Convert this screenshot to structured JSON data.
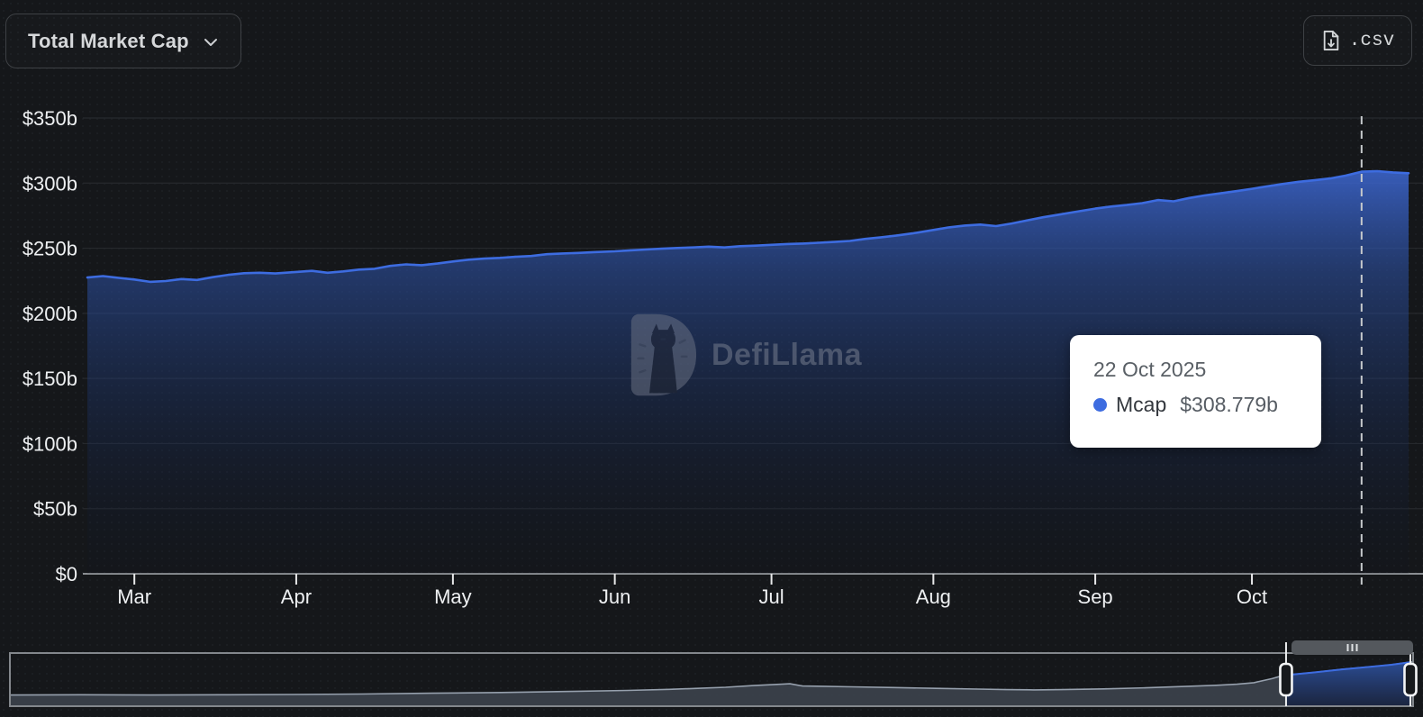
{
  "header": {
    "metric_selector_label": "Total Market Cap",
    "csv_button_label": ".csv"
  },
  "watermark": {
    "brand": "DefiLlama"
  },
  "tooltip": {
    "date": "22 Oct 2025",
    "series_label": "Mcap",
    "value": "$308.779b"
  },
  "colors": {
    "accent_blue": "#3d6ce0",
    "area_fill_top": "#2f57ac",
    "background": "#15171a",
    "axis_text": "#eef0f2",
    "grid_line": "#26292d",
    "axis_line": "#8a8e92",
    "crosshair": "#c6c9cc",
    "tooltip_bg": "#ffffff",
    "nav_gray_fill": "#3c424d",
    "nav_gray_line": "#96a0ad",
    "nav_border": "#83878c",
    "nav_handle": "#f4f5f6"
  },
  "chart_data": {
    "type": "area",
    "title": "Total Market Cap",
    "unit": "USD billions",
    "ylim": [
      0,
      350
    ],
    "grid": true,
    "legend_position": "none",
    "yticks": [
      {
        "value": 0,
        "label": "$0"
      },
      {
        "value": 50,
        "label": "$50b"
      },
      {
        "value": 100,
        "label": "$100b"
      },
      {
        "value": 150,
        "label": "$150b"
      },
      {
        "value": 200,
        "label": "$200b"
      },
      {
        "value": 250,
        "label": "$250b"
      },
      {
        "value": 300,
        "label": "$300b"
      },
      {
        "value": 350,
        "label": "$350b"
      }
    ],
    "xticks": [
      {
        "date": "2025-03-01",
        "label": "Mar"
      },
      {
        "date": "2025-04-01",
        "label": "Apr"
      },
      {
        "date": "2025-05-01",
        "label": "May"
      },
      {
        "date": "2025-06-01",
        "label": "Jun"
      },
      {
        "date": "2025-07-01",
        "label": "Jul"
      },
      {
        "date": "2025-08-01",
        "label": "Aug"
      },
      {
        "date": "2025-09-01",
        "label": "Sep"
      },
      {
        "date": "2025-10-01",
        "label": "Oct"
      }
    ],
    "highlighted_point": {
      "date": "2025-10-22",
      "value": 308.779,
      "label": "$308.779b"
    },
    "series": [
      {
        "name": "Mcap",
        "points": [
          [
            "2025-02-20",
            227.5
          ],
          [
            "2025-02-23",
            228.6
          ],
          [
            "2025-02-26",
            227.2
          ],
          [
            "2025-03-01",
            226.0
          ],
          [
            "2025-03-04",
            224.2
          ],
          [
            "2025-03-07",
            224.8
          ],
          [
            "2025-03-10",
            226.3
          ],
          [
            "2025-03-13",
            225.6
          ],
          [
            "2025-03-16",
            227.8
          ],
          [
            "2025-03-19",
            229.6
          ],
          [
            "2025-03-22",
            230.8
          ],
          [
            "2025-03-25",
            231.2
          ],
          [
            "2025-03-28",
            230.6
          ],
          [
            "2025-04-01",
            231.8
          ],
          [
            "2025-04-04",
            232.6
          ],
          [
            "2025-04-07",
            231.2
          ],
          [
            "2025-04-10",
            232.2
          ],
          [
            "2025-04-13",
            233.6
          ],
          [
            "2025-04-16",
            234.2
          ],
          [
            "2025-04-19",
            236.4
          ],
          [
            "2025-04-22",
            237.6
          ],
          [
            "2025-04-25",
            237.0
          ],
          [
            "2025-04-28",
            238.2
          ],
          [
            "2025-05-01",
            239.8
          ],
          [
            "2025-05-04",
            241.2
          ],
          [
            "2025-05-07",
            242.0
          ],
          [
            "2025-05-10",
            242.6
          ],
          [
            "2025-05-13",
            243.4
          ],
          [
            "2025-05-16",
            244.0
          ],
          [
            "2025-05-19",
            245.4
          ],
          [
            "2025-05-22",
            246.0
          ],
          [
            "2025-05-25",
            246.4
          ],
          [
            "2025-05-28",
            247.0
          ],
          [
            "2025-06-01",
            247.6
          ],
          [
            "2025-06-04",
            248.4
          ],
          [
            "2025-06-07",
            249.0
          ],
          [
            "2025-06-10",
            249.6
          ],
          [
            "2025-06-13",
            250.2
          ],
          [
            "2025-06-16",
            250.6
          ],
          [
            "2025-06-19",
            251.2
          ],
          [
            "2025-06-22",
            250.6
          ],
          [
            "2025-06-25",
            251.6
          ],
          [
            "2025-06-28",
            252.0
          ],
          [
            "2025-07-01",
            252.6
          ],
          [
            "2025-07-04",
            253.2
          ],
          [
            "2025-07-07",
            253.6
          ],
          [
            "2025-07-10",
            254.2
          ],
          [
            "2025-07-13",
            254.8
          ],
          [
            "2025-07-16",
            255.6
          ],
          [
            "2025-07-19",
            257.2
          ],
          [
            "2025-07-22",
            258.4
          ],
          [
            "2025-07-25",
            259.8
          ],
          [
            "2025-07-28",
            261.4
          ],
          [
            "2025-08-01",
            264.0
          ],
          [
            "2025-08-04",
            266.0
          ],
          [
            "2025-08-07",
            267.4
          ],
          [
            "2025-08-10",
            268.2
          ],
          [
            "2025-08-13",
            267.0
          ],
          [
            "2025-08-16",
            269.0
          ],
          [
            "2025-08-19",
            271.4
          ],
          [
            "2025-08-22",
            273.8
          ],
          [
            "2025-08-25",
            275.8
          ],
          [
            "2025-08-28",
            277.8
          ],
          [
            "2025-09-01",
            280.4
          ],
          [
            "2025-09-04",
            282.0
          ],
          [
            "2025-09-07",
            283.2
          ],
          [
            "2025-09-10",
            284.6
          ],
          [
            "2025-09-13",
            287.0
          ],
          [
            "2025-09-16",
            286.0
          ],
          [
            "2025-09-19",
            288.6
          ],
          [
            "2025-09-22",
            290.6
          ],
          [
            "2025-09-25",
            292.2
          ],
          [
            "2025-09-28",
            293.8
          ],
          [
            "2025-10-01",
            295.6
          ],
          [
            "2025-10-04",
            297.6
          ],
          [
            "2025-10-07",
            299.4
          ],
          [
            "2025-10-10",
            301.0
          ],
          [
            "2025-10-13",
            302.2
          ],
          [
            "2025-10-16",
            303.6
          ],
          [
            "2025-10-19",
            305.8
          ],
          [
            "2025-10-22",
            308.779
          ],
          [
            "2025-10-25",
            309.2
          ],
          [
            "2025-10-28",
            308.2
          ],
          [
            "2025-10-31",
            307.6
          ]
        ]
      }
    ],
    "navigator": {
      "points": [
        [
          0.0,
          0.2
        ],
        [
          0.05,
          0.205
        ],
        [
          0.1,
          0.2
        ],
        [
          0.15,
          0.205
        ],
        [
          0.2,
          0.21
        ],
        [
          0.25,
          0.22
        ],
        [
          0.3,
          0.235
        ],
        [
          0.35,
          0.25
        ],
        [
          0.4,
          0.27
        ],
        [
          0.44,
          0.29
        ],
        [
          0.47,
          0.31
        ],
        [
          0.49,
          0.33
        ],
        [
          0.51,
          0.35
        ],
        [
          0.53,
          0.385
        ],
        [
          0.55,
          0.41
        ],
        [
          0.556,
          0.42
        ],
        [
          0.565,
          0.375
        ],
        [
          0.58,
          0.37
        ],
        [
          0.6,
          0.36
        ],
        [
          0.63,
          0.345
        ],
        [
          0.66,
          0.33
        ],
        [
          0.69,
          0.315
        ],
        [
          0.71,
          0.305
        ],
        [
          0.73,
          0.3
        ],
        [
          0.75,
          0.305
        ],
        [
          0.78,
          0.32
        ],
        [
          0.81,
          0.34
        ],
        [
          0.84,
          0.37
        ],
        [
          0.86,
          0.39
        ],
        [
          0.875,
          0.41
        ],
        [
          0.887,
          0.44
        ],
        [
          0.9,
          0.52
        ],
        [
          0.905,
          0.56
        ],
        [
          0.915,
          0.6
        ],
        [
          0.93,
          0.64
        ],
        [
          0.95,
          0.7
        ],
        [
          0.97,
          0.75
        ],
        [
          0.985,
          0.79
        ],
        [
          1.0,
          0.845
        ]
      ],
      "selection": {
        "start_frac": 0.91,
        "end_frac": 0.9987
      }
    }
  }
}
